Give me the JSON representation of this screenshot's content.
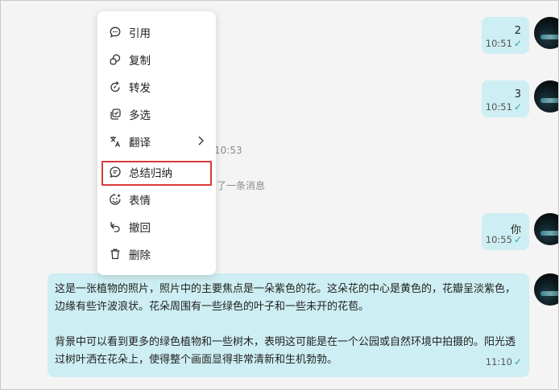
{
  "messages": [
    {
      "text": "2",
      "time": "10:51"
    },
    {
      "text": "3",
      "time": "10:51"
    },
    {
      "text": "你",
      "time": "10:55"
    }
  ],
  "partial_time": "10:53",
  "recall_notice": "了一条消息",
  "long_message": {
    "paragraph1": "这是一张植物的照片，照片中的主要焦点是一朵紫色的花。这朵花的中心是黄色的，花瓣呈淡紫色，边缘有些许波浪状。花朵周围有一些绿色的叶子和一些未开的花苞。",
    "paragraph2": "背景中可以看到更多的绿色植物和一些树木，表明这可能是在一个公园或自然环境中拍摄的。阳光透过树叶洒在花朵上，使得整个画面显得非常清新和生机勃勃。",
    "time": "11:10"
  },
  "context_menu": {
    "items": [
      {
        "label": "引用",
        "icon": "quote-icon"
      },
      {
        "label": "复制",
        "icon": "copy-icon"
      },
      {
        "label": "转发",
        "icon": "forward-icon"
      },
      {
        "label": "多选",
        "icon": "multi-select-icon"
      },
      {
        "label": "翻译",
        "icon": "translate-icon"
      },
      {
        "label": "总结归纳",
        "icon": "summarize-icon"
      },
      {
        "label": "表情",
        "icon": "emoji-icon"
      },
      {
        "label": "撤回",
        "icon": "recall-icon"
      },
      {
        "label": "删除",
        "icon": "delete-icon"
      }
    ],
    "highlighted": "总结归纳"
  },
  "colors": {
    "bubble": "#cdeef2",
    "check": "#2a9fb5",
    "highlight": "#d93a3a"
  }
}
